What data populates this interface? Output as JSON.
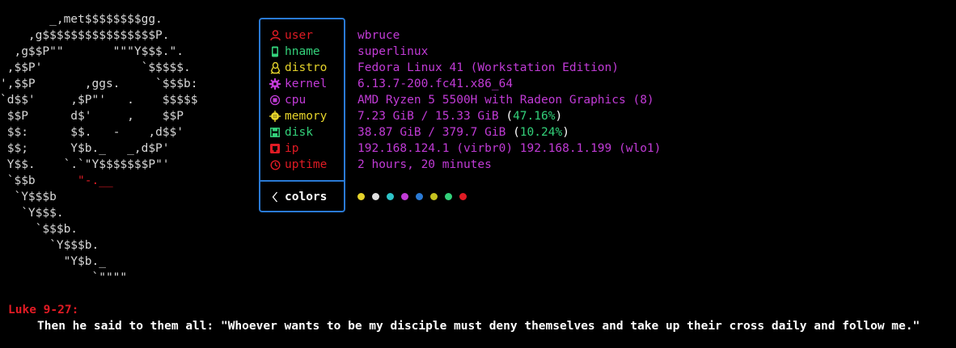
{
  "logo": {
    "lines": [
      "       _,met$$$$$$$$gg.",
      "    ,g$$$$$$$$$$$$$$$$P.",
      "  ,g$$P\"\"       \"\"\"Y$$$.\".",
      " ,$$P'              `$$$$$.",
      "',$$P       ,ggs.     `$$$b:",
      "`d$$'     ,$P\"'   .    $$$$$",
      " $$P      d$'     ,    $$P",
      " $$:      $$.   -    ,d$$'",
      " $$;      Y$b._   _,d$P'",
      " Y$$.    `.`\"Y$$$$$$$P\"'",
      " `$$b      \"-.__",
      "  `Y$$$b",
      "   `Y$$$.",
      "     `$$$b.",
      "       `Y$$$b.",
      "         \"Y$b._",
      "             `\"\"\"\""
    ]
  },
  "info": [
    {
      "icon": "user-icon",
      "key": "user",
      "value": "wbruce",
      "key_color": "#e01b24",
      "icon_color": "#e01b24"
    },
    {
      "icon": "phone-icon",
      "key": "hname",
      "value": "superlinux",
      "key_color": "#33d17a",
      "icon_color": "#33d17a"
    },
    {
      "icon": "linux-tux-icon",
      "key": "distro",
      "value": "Fedora Linux 41 (Workstation Edition)",
      "key_color": "#e5d32b",
      "icon_color": "#e5d32b"
    },
    {
      "icon": "gear-icon",
      "key": "kernel",
      "value": "6.13.7-200.fc41.x86_64",
      "key_color": "#c13bd6",
      "icon_color": "#c13bd6"
    },
    {
      "icon": "cpu-icon",
      "key": "cpu",
      "value": "AMD Ryzen 5 5500H with Radeon Graphics (8)",
      "key_color": "#c13bd6",
      "icon_color": "#c13bd6"
    },
    {
      "icon": "memory-icon",
      "key": "memory",
      "value_main": "7.23 GiB / 15.33 GiB ",
      "value_pct": "47.16%",
      "key_color": "#e5d32b",
      "icon_color": "#e5d32b"
    },
    {
      "icon": "disk-icon",
      "key": "disk",
      "value_main": "38.87 GiB / 379.7 GiB ",
      "value_pct": "10.24%",
      "key_color": "#33d17a",
      "icon_color": "#33d17a"
    },
    {
      "icon": "network-icon",
      "key": "ip",
      "value": "192.168.124.1 (virbr0) 192.168.1.199 (wlo1)",
      "key_color": "#e01b24",
      "icon_color": "#e01b24"
    },
    {
      "icon": "clock-icon",
      "key": "uptime",
      "value": "2 hours, 20 minutes",
      "key_color": "#e01b24",
      "icon_color": "#e01b24"
    }
  ],
  "colors_row": {
    "label": "colors",
    "icon": "chevron-left-icon",
    "palette": [
      "#e5d32b",
      "#e0e0e0",
      "#2ec4c9",
      "#c13bd6",
      "#2a7ad5",
      "#c5c21f",
      "#33d17a",
      "#e01b24"
    ]
  },
  "verse": {
    "reference": "Luke 9-27:",
    "text": "Then he said to them all: \"Whoever wants to be my disciple must deny themselves and take up their cross daily and follow me.\""
  },
  "colors": {
    "border": "#2a7ad5",
    "value": "#c13bd6",
    "percent": "#33d17a",
    "verse_ref": "#e01b24"
  }
}
